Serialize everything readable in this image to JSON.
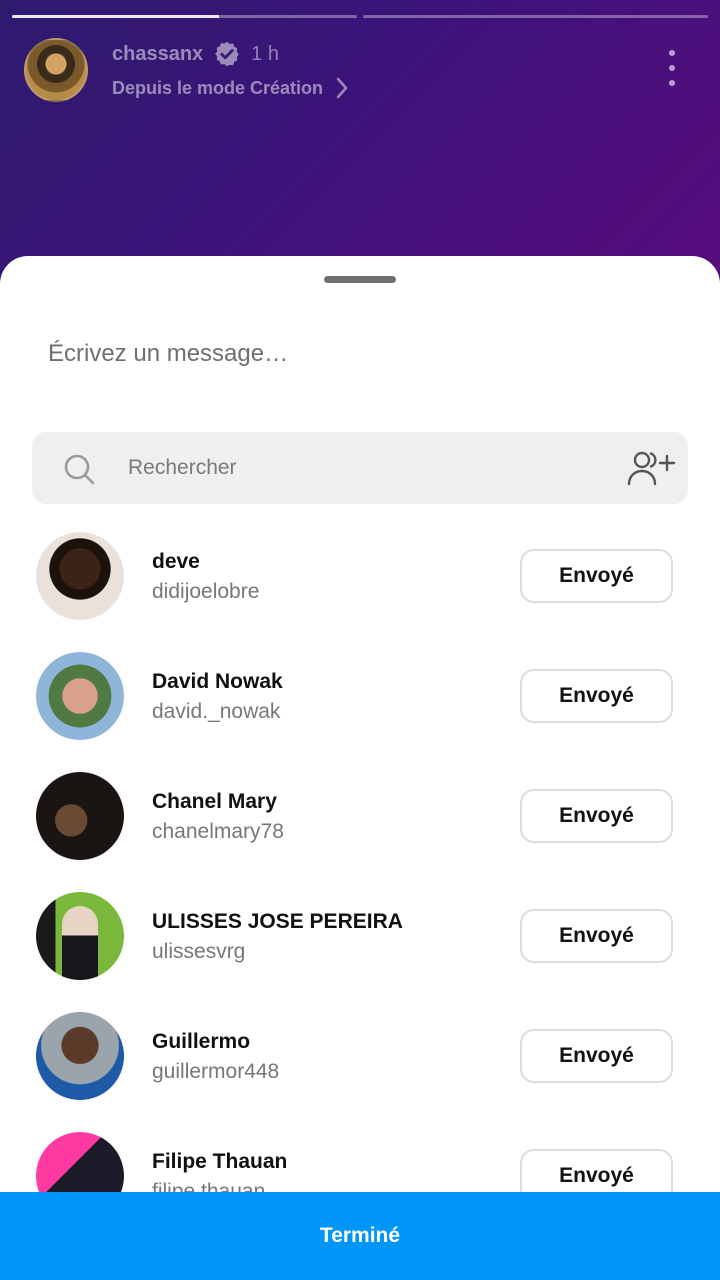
{
  "story": {
    "username": "chassanx",
    "time": "1 h",
    "subtitle": "Depuis le mode Création",
    "progress": [
      0.6,
      0.0
    ]
  },
  "share": {
    "message_placeholder": "Écrivez un message…",
    "search_placeholder": "Rechercher",
    "done_label": "Terminé"
  },
  "contacts": [
    {
      "name": "deve",
      "username": "didijoelobre",
      "button": "Envoyé"
    },
    {
      "name": "David Nowak",
      "username": "david._nowak",
      "button": "Envoyé"
    },
    {
      "name": "Chanel Mary",
      "username": "chanelmary78",
      "button": "Envoyé"
    },
    {
      "name": "ULISSES JOSE PEREIRA",
      "username": "ulissesvrg",
      "button": "Envoyé"
    },
    {
      "name": "Guillermo",
      "username": "guillermor448",
      "button": "Envoyé"
    },
    {
      "name": "Filipe Thauan",
      "username": "filipe.thauan",
      "button": "Envoyé"
    }
  ],
  "colors": {
    "accent": "#0095f6",
    "story_gradient_start": "#2e1b6e",
    "story_gradient_end": "#5a0b7c"
  }
}
